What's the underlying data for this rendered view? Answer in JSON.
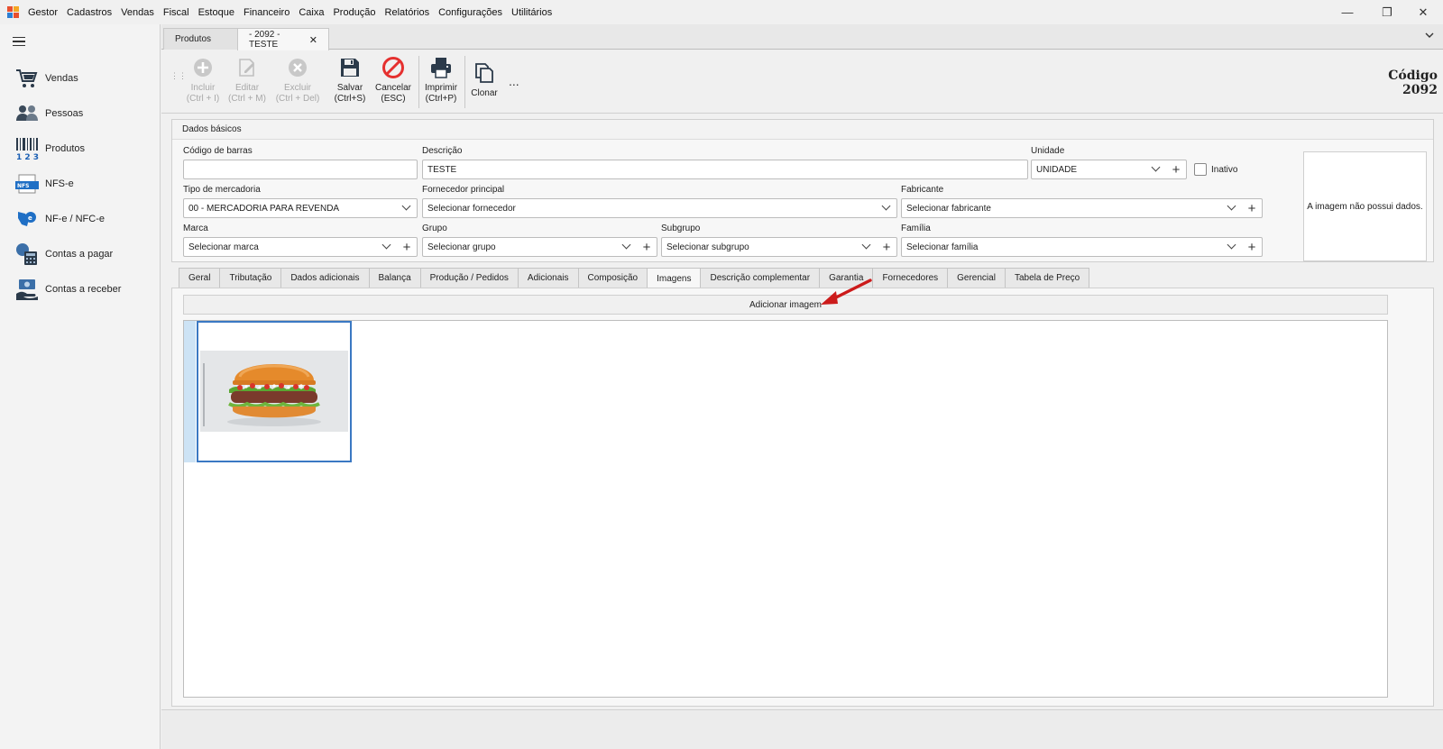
{
  "menubar": {
    "items": [
      "Gestor",
      "Cadastros",
      "Vendas",
      "Fiscal",
      "Estoque",
      "Financeiro",
      "Caixa",
      "Produção",
      "Relatórios",
      "Configurações",
      "Utilitários"
    ],
    "window_controls": {
      "minimize": "—",
      "restore": "❐",
      "close": "✕"
    }
  },
  "sidebar": {
    "items": [
      {
        "label": "Vendas",
        "icon": "cart-icon"
      },
      {
        "label": "Pessoas",
        "icon": "people-icon"
      },
      {
        "label": "Produtos",
        "icon": "barcode-icon"
      },
      {
        "label": "NFS-e",
        "icon": "nfse-icon"
      },
      {
        "label": "NF-e / NFC-e",
        "icon": "nfe-icon"
      },
      {
        "label": "Contas a pagar",
        "icon": "calculator-icon"
      },
      {
        "label": "Contas a receber",
        "icon": "money-hand-icon"
      }
    ]
  },
  "doc_tabs": [
    {
      "label": "Produtos"
    },
    {
      "label": "- 2092 - TESTE",
      "close": "✕"
    }
  ],
  "toolbar": {
    "buttons": [
      {
        "label1": "Incluir",
        "label2": "(Ctrl + I)"
      },
      {
        "label1": "Editar",
        "label2": "(Ctrl + M)"
      },
      {
        "label1": "Excluir",
        "label2": "(Ctrl + Del)"
      },
      {
        "label1": "Salvar",
        "label2": "(Ctrl+S)"
      },
      {
        "label1": "Cancelar",
        "label2": "(ESC)"
      },
      {
        "label1": "Imprimir",
        "label2": "(Ctrl+P)"
      },
      {
        "label1": "Clonar",
        "label2": ""
      }
    ],
    "more": "...",
    "codigo_label": "Código",
    "codigo_value": "2092"
  },
  "dados_basicos": {
    "title": "Dados básicos",
    "codigo_barras": {
      "label": "Código de barras",
      "value": ""
    },
    "descricao": {
      "label": "Descrição",
      "value": "TESTE"
    },
    "unidade": {
      "label": "Unidade",
      "value": "UNIDADE"
    },
    "inativo": {
      "label": "Inativo"
    },
    "tipo_mercadoria": {
      "label": "Tipo de mercadoria",
      "value": "00 - MERCADORIA PARA REVENDA"
    },
    "fornecedor": {
      "label": "Fornecedor principal",
      "value": "Selecionar fornecedor"
    },
    "fabricante": {
      "label": "Fabricante",
      "value": "Selecionar fabricante"
    },
    "marca": {
      "label": "Marca",
      "value": "Selecionar marca"
    },
    "grupo": {
      "label": "Grupo",
      "value": "Selecionar grupo"
    },
    "subgrupo": {
      "label": "Subgrupo",
      "value": "Selecionar subgrupo"
    },
    "familia": {
      "label": "Família",
      "value": "Selecionar família"
    },
    "image_placeholder": "A imagem não possui dados."
  },
  "content_tabs": [
    "Geral",
    "Tributação",
    "Dados adicionais",
    "Balança",
    "Produção / Pedidos",
    "Adicionais",
    "Composição",
    "Imagens",
    "Descrição complementar",
    "Garantia",
    "Fornecedores",
    "Gerencial",
    "Tabela de Preço"
  ],
  "active_tab": "Imagens",
  "imagens": {
    "add_button": "Adicionar imagem"
  }
}
